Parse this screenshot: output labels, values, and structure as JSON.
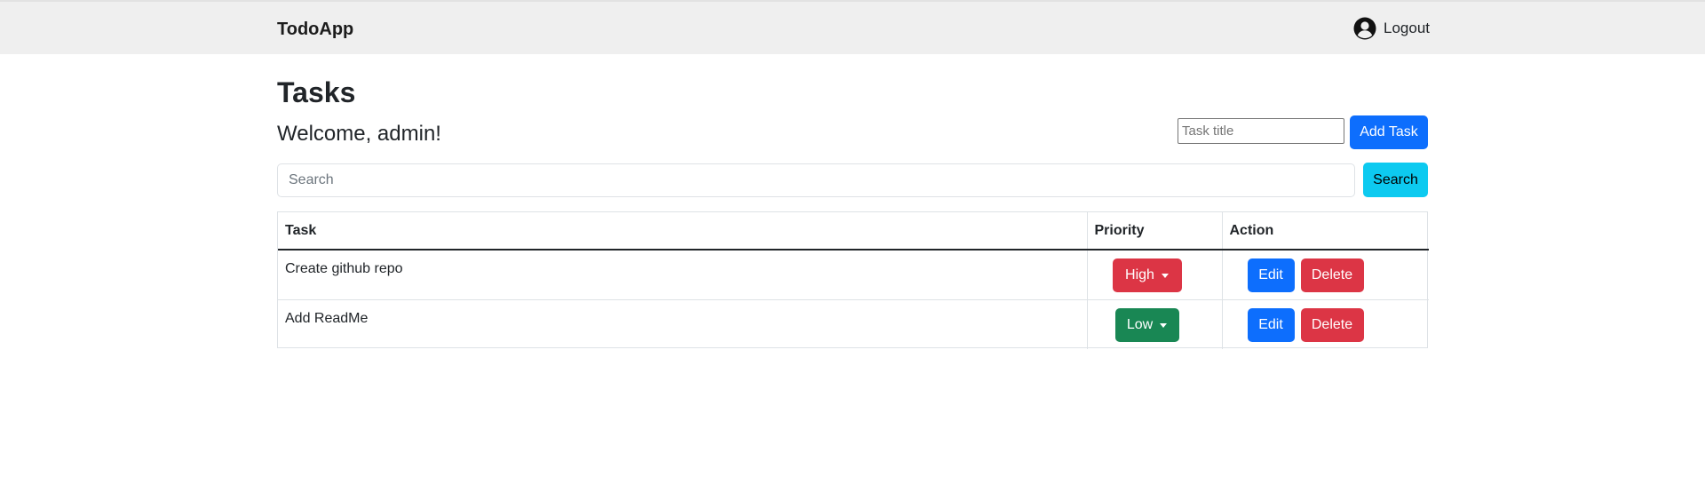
{
  "navbar": {
    "brand": "TodoApp",
    "logout_label": "Logout",
    "logout_icon": "user-circle-icon"
  },
  "page": {
    "title": "Tasks",
    "welcome": "Welcome, admin!"
  },
  "add_task": {
    "placeholder": "Task title",
    "value": "",
    "button_label": "Add Task"
  },
  "search": {
    "placeholder": "Search",
    "value": "",
    "button_label": "Search"
  },
  "table": {
    "headers": [
      "Task",
      "Priority",
      "Action"
    ],
    "rows": [
      {
        "task": "Create github repo",
        "priority": "High",
        "priority_color": "#dc3545",
        "edit_label": "Edit",
        "delete_label": "Delete"
      },
      {
        "task": "Add ReadMe",
        "priority": "Low",
        "priority_color": "#198754",
        "edit_label": "Edit",
        "delete_label": "Delete"
      }
    ]
  },
  "colors": {
    "primary": "#0d6efd",
    "info": "#0dcaf0",
    "danger": "#dc3545",
    "success": "#198754",
    "navbar_bg": "#efefef"
  }
}
